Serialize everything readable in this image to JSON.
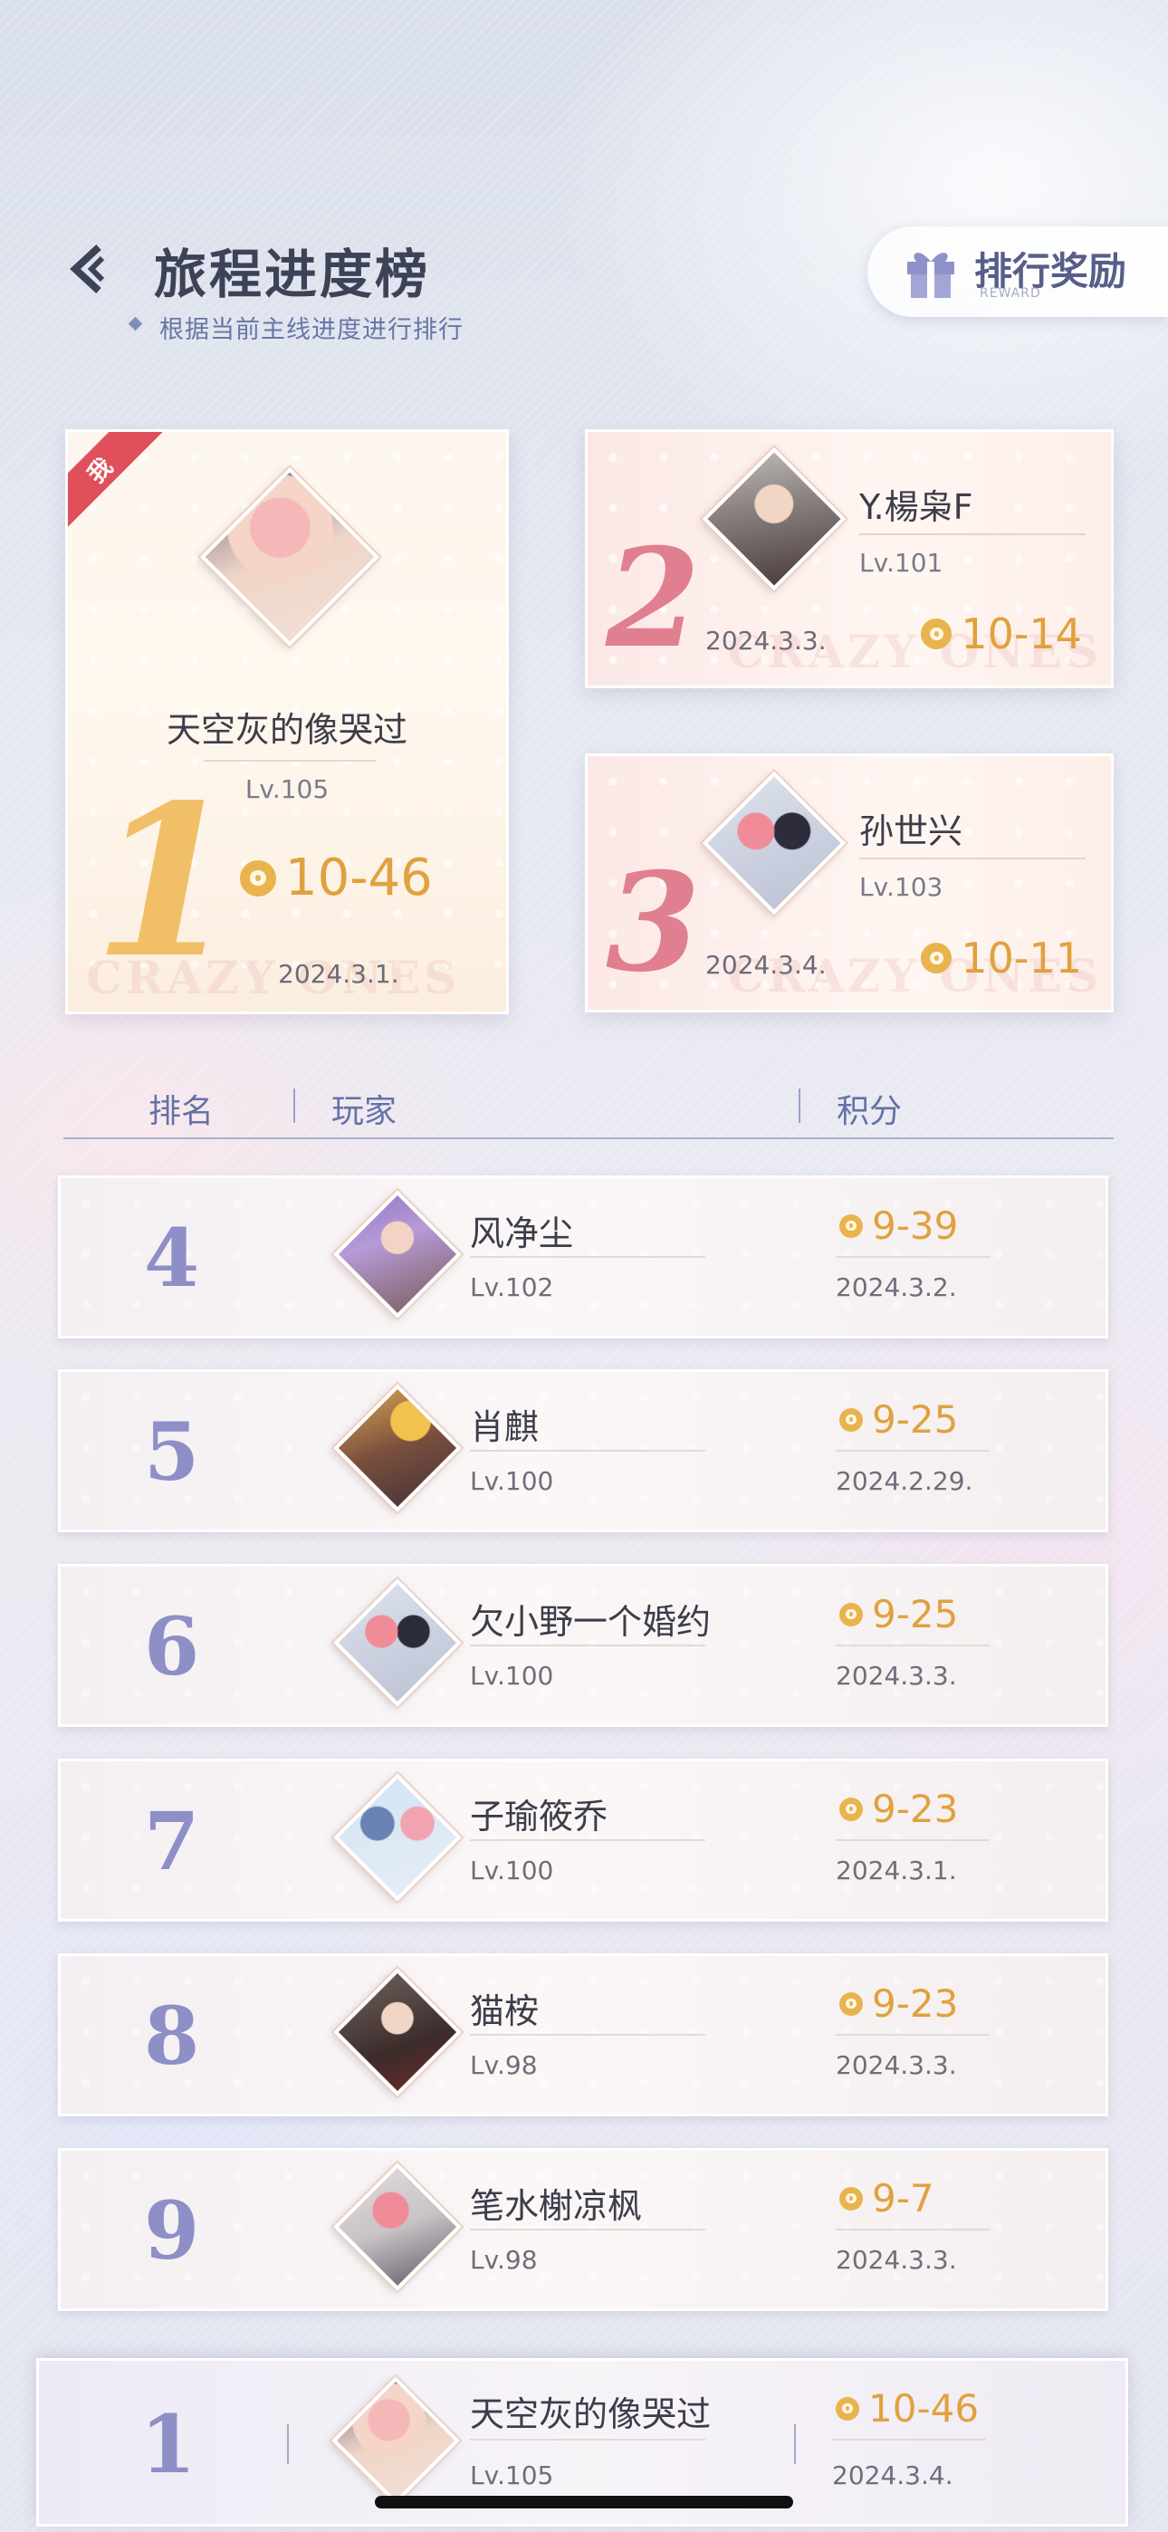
{
  "header": {
    "title": "旅程进度榜",
    "subtitle": "根据当前主线进度进行排行",
    "reward_button": {
      "label": "排行奖励",
      "sublabel": "REWARD"
    }
  },
  "podium": [
    {
      "rank": "1",
      "me_tag": "我",
      "name": "天空灰的像哭过",
      "level": "Lv.105",
      "score": "10-46",
      "date": "2024.3.1.",
      "watermark": "CRAZY ONES"
    },
    {
      "rank": "2",
      "name": "Y.楊枭F",
      "level": "Lv.101",
      "score": "10-14",
      "date": "2024.3.3.",
      "watermark": "CRAZY ONES"
    },
    {
      "rank": "3",
      "name": "孙世兴",
      "level": "Lv.103",
      "score": "10-11",
      "date": "2024.3.4.",
      "watermark": "CRAZY ONES"
    }
  ],
  "table_header": {
    "rank": "排名",
    "player": "玩家",
    "score": "积分"
  },
  "rows": [
    {
      "rank": "4",
      "name": "风净尘",
      "level": "Lv.102",
      "score": "9-39",
      "date": "2024.3.2."
    },
    {
      "rank": "5",
      "name": "肖麒",
      "level": "Lv.100",
      "score": "9-25",
      "date": "2024.2.29."
    },
    {
      "rank": "6",
      "name": "欠小野一个婚约",
      "level": "Lv.100",
      "score": "9-25",
      "date": "2024.3.3."
    },
    {
      "rank": "7",
      "name": "子瑜筱乔",
      "level": "Lv.100",
      "score": "9-23",
      "date": "2024.3.1."
    },
    {
      "rank": "8",
      "name": "猫桉",
      "level": "Lv.98",
      "score": "9-23",
      "date": "2024.3.3."
    },
    {
      "rank": "9",
      "name": "笔水榭凉枫",
      "level": "Lv.98",
      "score": "9-7",
      "date": "2024.3.3."
    }
  ],
  "self_row": {
    "rank": "1",
    "name": "天空灰的像哭过",
    "level": "Lv.105",
    "score": "10-46",
    "date": "2024.3.4."
  },
  "icons": {
    "back": "back-arrow-icon",
    "reward": "gift-icon",
    "score": "film-reel-icon"
  },
  "colors": {
    "accent": "#e0a13e",
    "rank_purple": "#8d8fc6",
    "rank_pink": "#e07f8f",
    "rank_gold": "#f1bf68",
    "me_ribbon": "#e0505c"
  }
}
